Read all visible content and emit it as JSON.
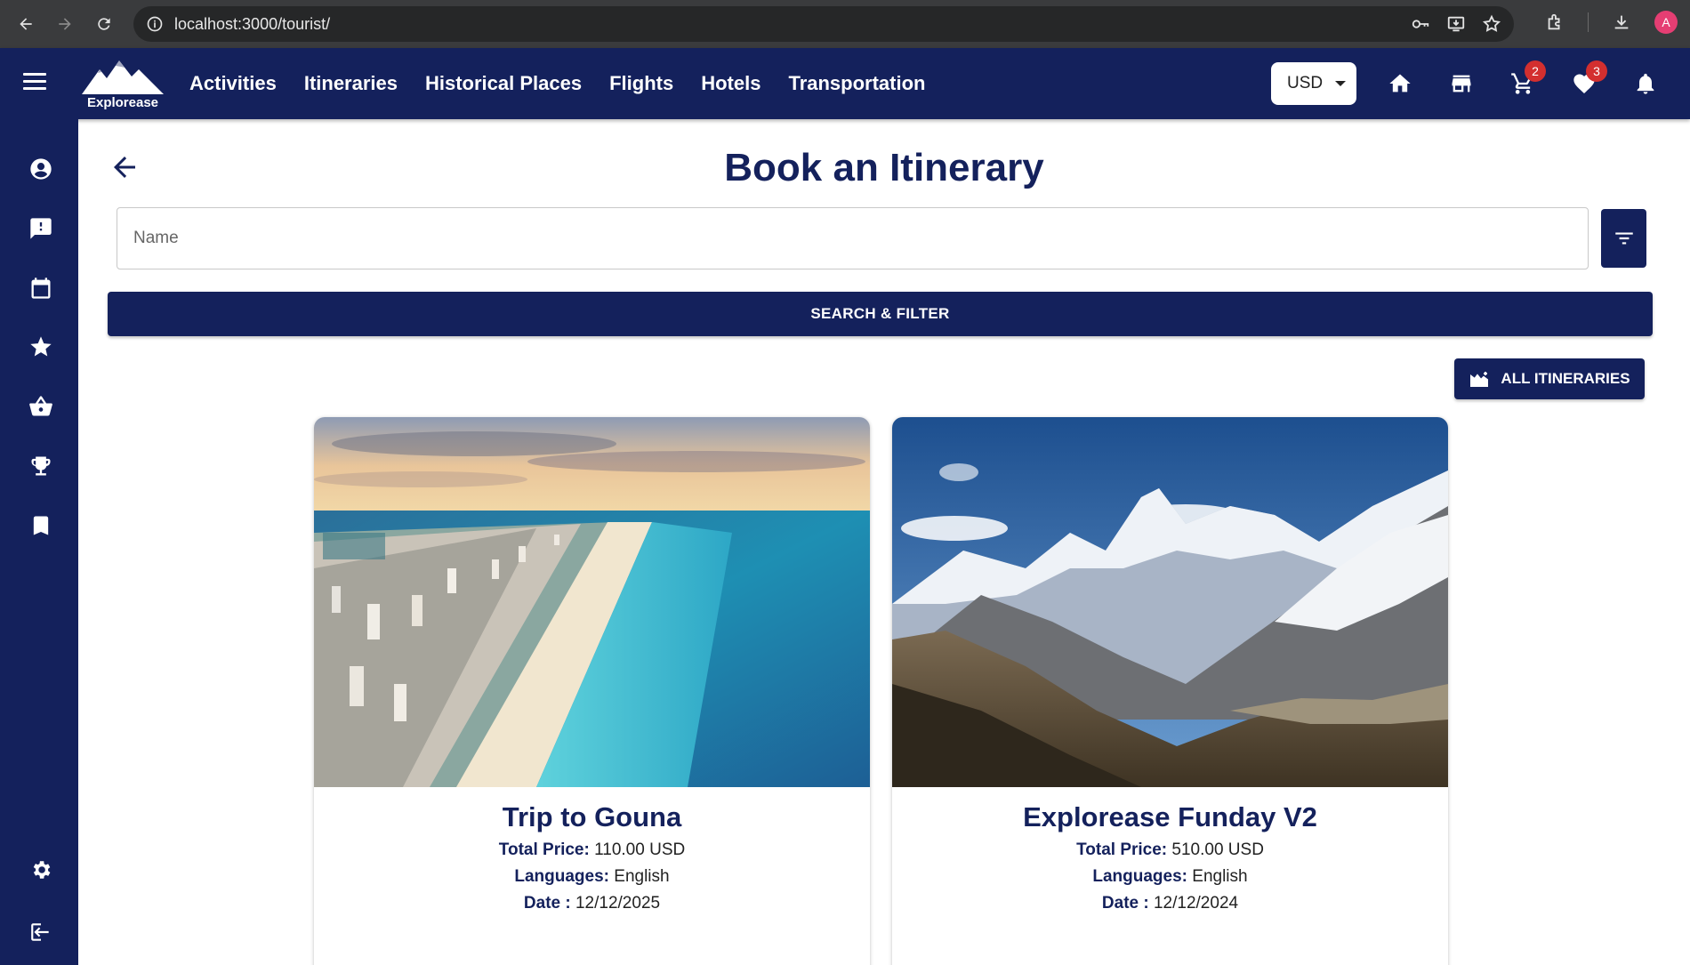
{
  "browser": {
    "url": "localhost:3000/tourist/",
    "profile_initial": "A"
  },
  "appbar": {
    "logo_text": "Explorease",
    "nav": [
      "Activities",
      "Itineraries",
      "Historical Places",
      "Flights",
      "Hotels",
      "Transportation"
    ],
    "currency": "USD",
    "cart_count": "2",
    "wishlist_count": "3"
  },
  "page": {
    "title": "Book an Itinerary",
    "search_placeholder": "Name",
    "search_filter_label": "SEARCH & FILTER",
    "all_itineraries_label": "ALL ITINERARIES"
  },
  "cards": [
    {
      "name": "Trip to Gouna",
      "price_label": "Total Price:",
      "price": "110.00 USD",
      "languages_label": "Languages:",
      "languages": "English",
      "date_label": "Date :",
      "date": "12/12/2025"
    },
    {
      "name": "Explorease Funday V2",
      "price_label": "Total Price:",
      "price": "510.00 USD",
      "languages_label": "Languages:",
      "languages": "English",
      "date_label": "Date :",
      "date": "12/12/2024"
    }
  ],
  "colors": {
    "primary": "#14215c",
    "badge": "#d32f2f"
  }
}
